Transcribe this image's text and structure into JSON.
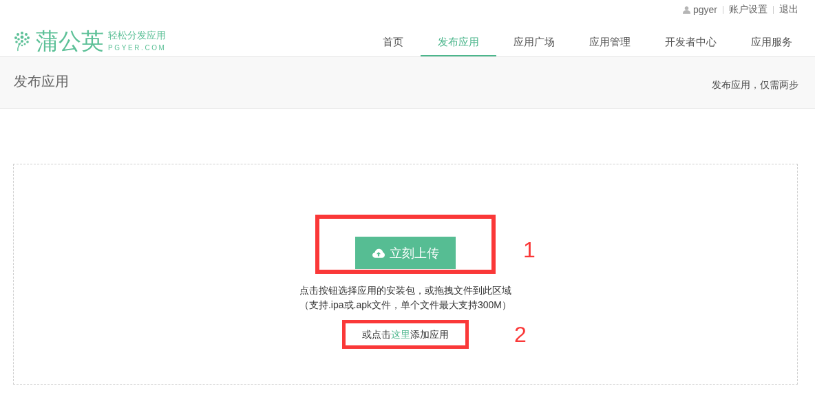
{
  "header": {
    "logo": {
      "name": "蒲公英",
      "tagline": "轻松分发应用",
      "domain": "PGYER.COM"
    },
    "user_links": [
      {
        "kind": "user",
        "label": "pgyer"
      },
      {
        "kind": "link",
        "label": "账户设置"
      },
      {
        "kind": "link",
        "label": "退出"
      }
    ]
  },
  "nav": [
    {
      "label": "首页",
      "selected": false
    },
    {
      "label": "发布应用",
      "selected": true
    },
    {
      "label": "应用广场",
      "selected": false
    },
    {
      "label": "应用管理",
      "selected": false
    },
    {
      "label": "开发者中心",
      "selected": false
    },
    {
      "label": "应用服务",
      "selected": false
    }
  ],
  "page_header": {
    "title": "发布应用",
    "subtitle": "发布应用，仅需两步"
  },
  "upload": {
    "button": "立刻上传",
    "hint_lines": [
      "点击按钮选择应用的安装包，或拖拽文件到此区域",
      "（支持.ipa或.apk文件，单个文件最大支持300M）"
    ],
    "add_link": {
      "before": "或点击",
      "link": "这里",
      "after": "添加应用"
    }
  },
  "annotations": [
    {
      "label": "1"
    },
    {
      "label": "2"
    }
  ]
}
